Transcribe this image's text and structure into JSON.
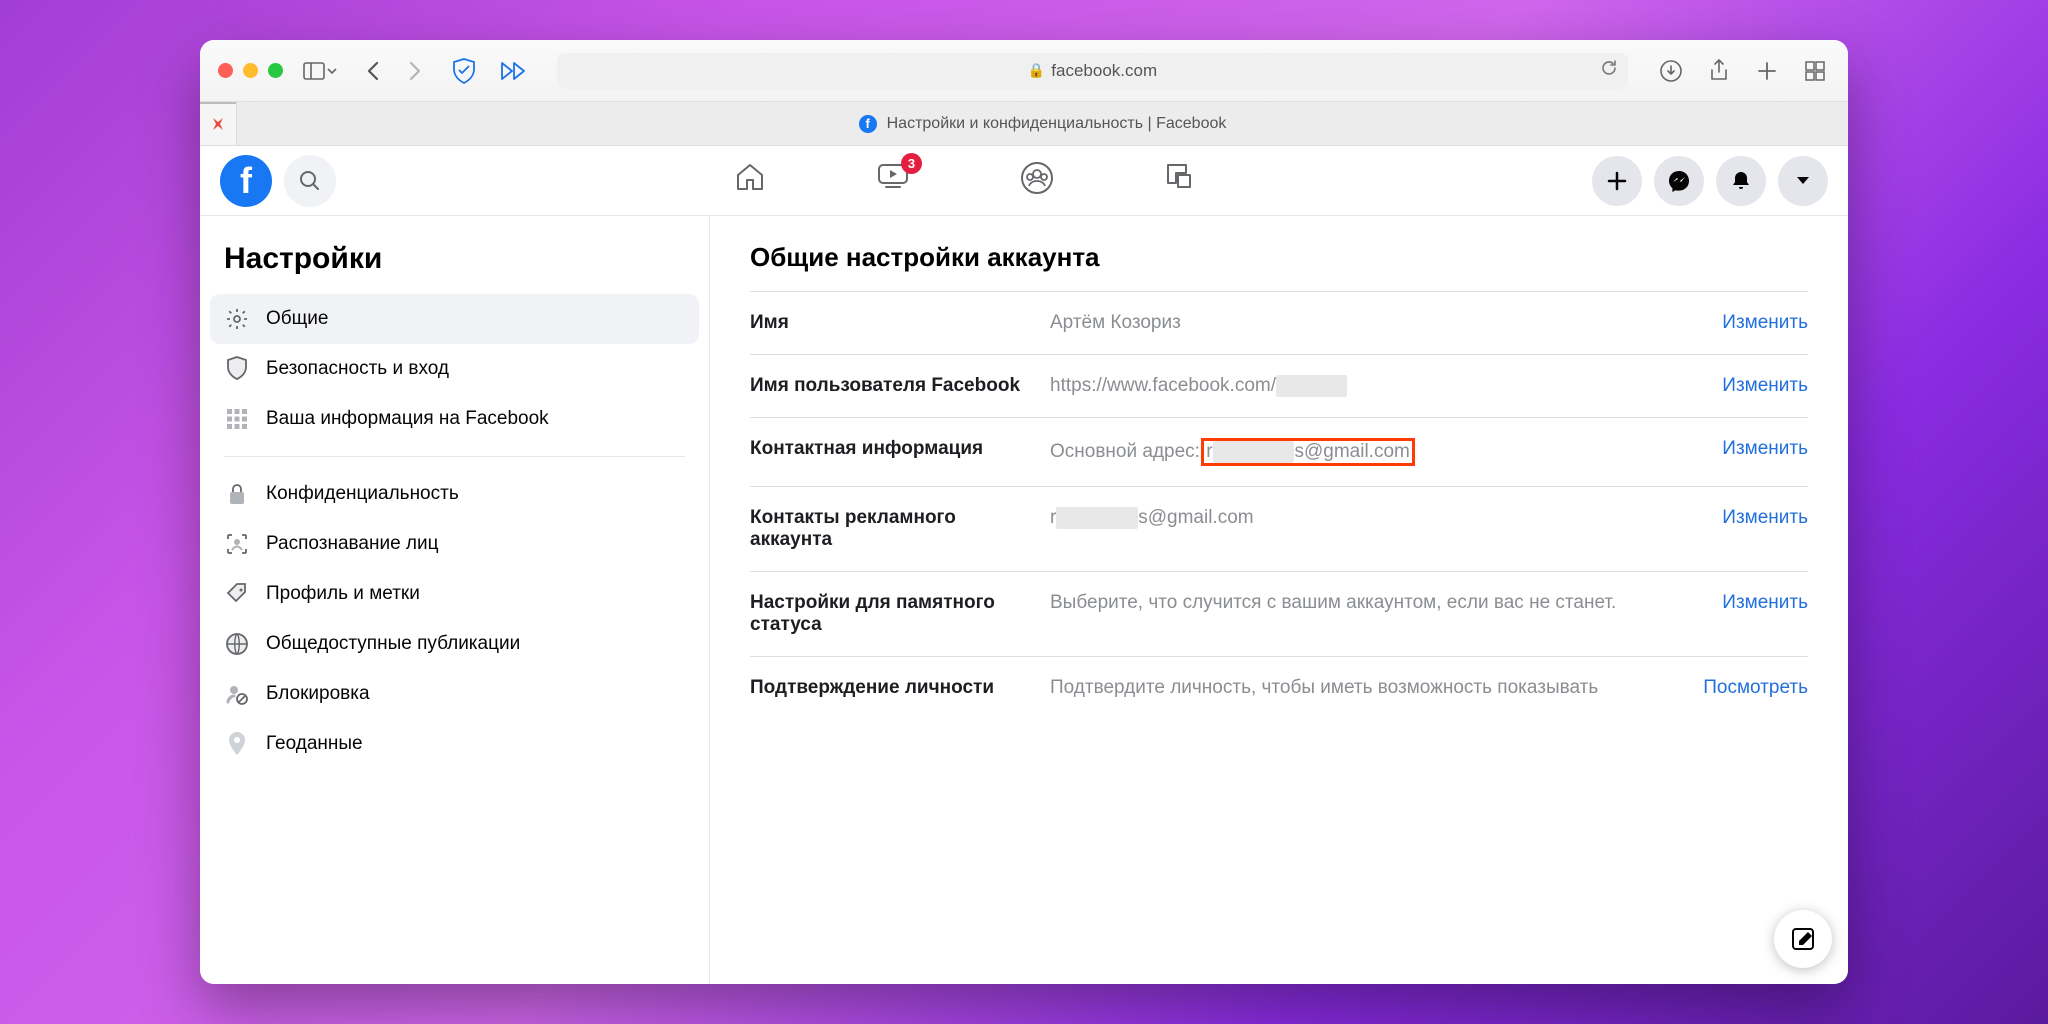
{
  "browser": {
    "url": "facebook.com",
    "tab_title": "Настройки и конфиденциальность | Facebook"
  },
  "fb_header": {
    "notif_badge": "3"
  },
  "sidebar": {
    "title": "Настройки",
    "items": [
      {
        "label": "Общие"
      },
      {
        "label": "Безопасность и вход"
      },
      {
        "label": "Ваша информация на Facebook"
      },
      {
        "label": "Конфиденциальность"
      },
      {
        "label": "Распознавание лиц"
      },
      {
        "label": "Профиль и метки"
      },
      {
        "label": "Общедоступные публикации"
      },
      {
        "label": "Блокировка"
      },
      {
        "label": "Геоданные"
      }
    ]
  },
  "main": {
    "title": "Общие настройки аккаунта",
    "action_edit": "Изменить",
    "action_view": "Посмотреть",
    "rows": {
      "name": {
        "label": "Имя",
        "value": "Артём Козориз"
      },
      "username": {
        "label": "Имя пользователя Facebook",
        "value": "https://www.facebook.com/"
      },
      "contact": {
        "label": "Контактная информация",
        "prefix": "Основной адрес:",
        "value_start": "r",
        "value_end": "s@gmail.com"
      },
      "adcontact": {
        "label": "Контакты рекламного аккаунта",
        "value_start": "r",
        "value_end": "s@gmail.com"
      },
      "memorial": {
        "label": "Настройки для памятного статуса",
        "value": "Выберите, что случится с вашим аккаунтом, если вас не станет."
      },
      "identity": {
        "label": "Подтверждение личности",
        "value": "Подтвердите личность, чтобы иметь возможность показывать"
      }
    }
  }
}
